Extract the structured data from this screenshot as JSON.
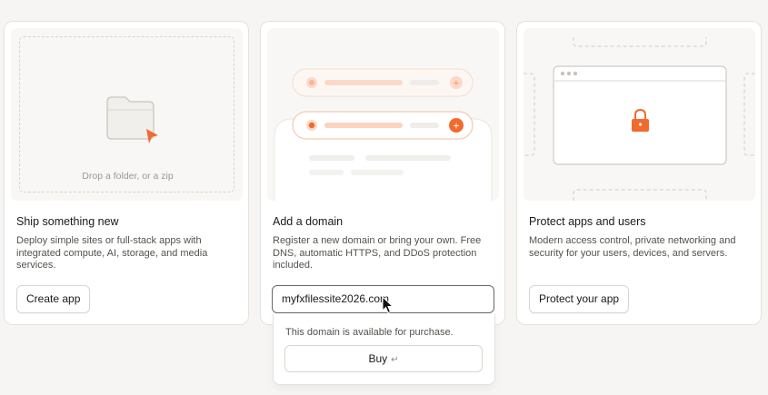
{
  "cards": [
    {
      "title": "Ship something new",
      "description": "Deploy simple sites or full-stack apps with integrated compute, AI, storage, and media services.",
      "button_label": "Create app",
      "illustration": {
        "drop_text": "Drop a folder, or a zip",
        "icons": [
          "folder-icon",
          "arrow-cursor-icon"
        ]
      }
    },
    {
      "title": "Add a domain",
      "description": "Register a new domain or bring your own. Free DNS, automatic HTTPS, and DDoS protection included.",
      "input_value": "myfxfilessite2026.com",
      "popover": {
        "availability_text": "This domain is available for purchase.",
        "buy_label": "Buy",
        "enter_hint": "↵"
      }
    },
    {
      "title": "Protect apps and users",
      "description": "Modern access control, private networking and security for your users, devices, and servers.",
      "button_label": "Protect your app",
      "illustration": {
        "icons": [
          "lock-icon"
        ]
      }
    }
  ],
  "colors": {
    "accent": "#f26a2e",
    "accent_light": "#fbd9c8",
    "background": "#f6f5f3"
  }
}
